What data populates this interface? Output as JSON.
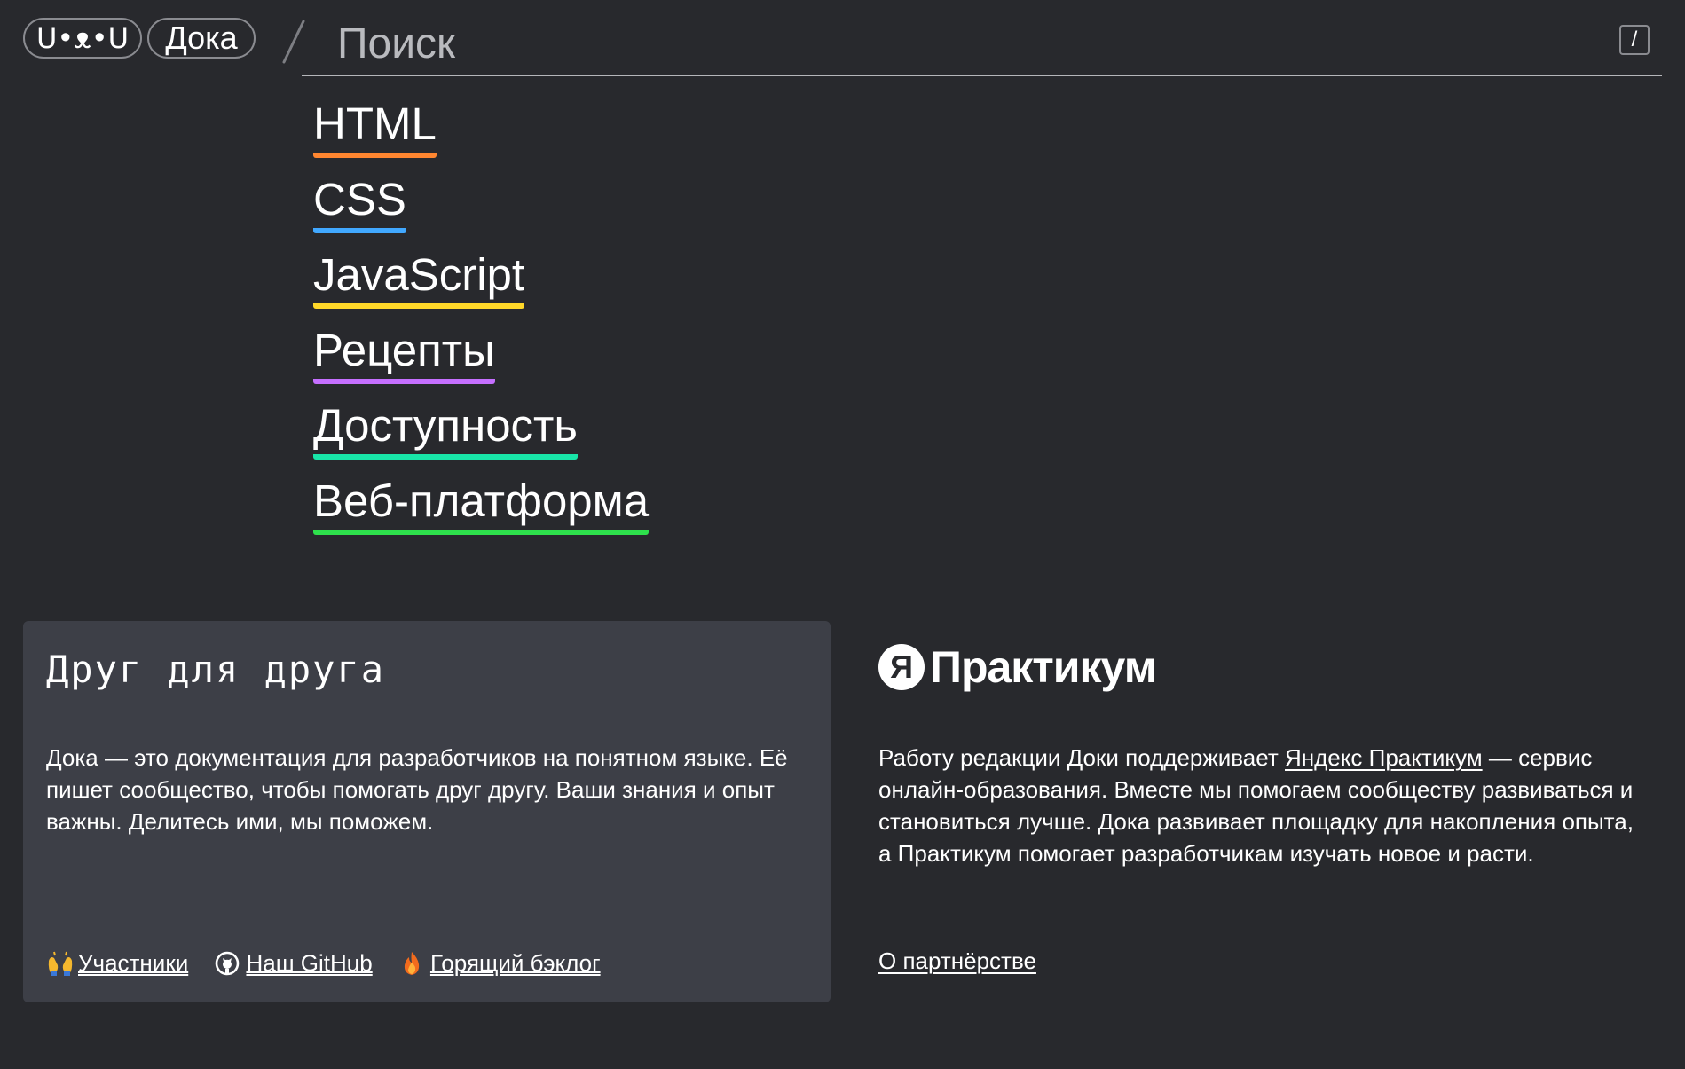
{
  "header": {
    "logo_label": "U•ᴥ•U",
    "site_name": "Дока",
    "search_placeholder": "Поиск",
    "search_hotkey": "/"
  },
  "nav": [
    {
      "label": "HTML",
      "color": "#ff8630"
    },
    {
      "label": "CSS",
      "color": "#41a8ff"
    },
    {
      "label": "JavaScript",
      "color": "#ffd829"
    },
    {
      "label": "Рецепты",
      "color": "#c56fff"
    },
    {
      "label": "Доступность",
      "color": "#18e5a8"
    },
    {
      "label": "Веб-платформа",
      "color": "#2ee04c"
    }
  ],
  "card": {
    "title": "Друг для друга",
    "text": "Дока — это документация для разработчиков на понятном языке. Её пишет сообщество, чтобы помогать друг другу. Ваши знания и опыт важны. Делитесь ими, мы поможем.",
    "links": [
      {
        "icon": "raised-hands-icon",
        "label": "Участники"
      },
      {
        "icon": "github-icon",
        "label": "Наш GitHub"
      },
      {
        "icon": "fire-icon",
        "label": "Горящий бэклог"
      }
    ]
  },
  "partner": {
    "logo_letter": "Я",
    "logo_name": "Практикум",
    "text_before": "Работу редакции Доки поддерживает ",
    "text_link": "Яндекс Практикум",
    "text_after": " — сервис онлайн-образования. Вместе мы помогаем сообществу развиваться и становиться лучше. Дока развивает площадку для накопления опыта, а Практикум помогает разработчикам изучать новое и расти.",
    "link_label": "О партнёрстве"
  },
  "colors": {
    "background": "#28292d",
    "card_background": "#3d3f47",
    "text": "#ffffff"
  }
}
